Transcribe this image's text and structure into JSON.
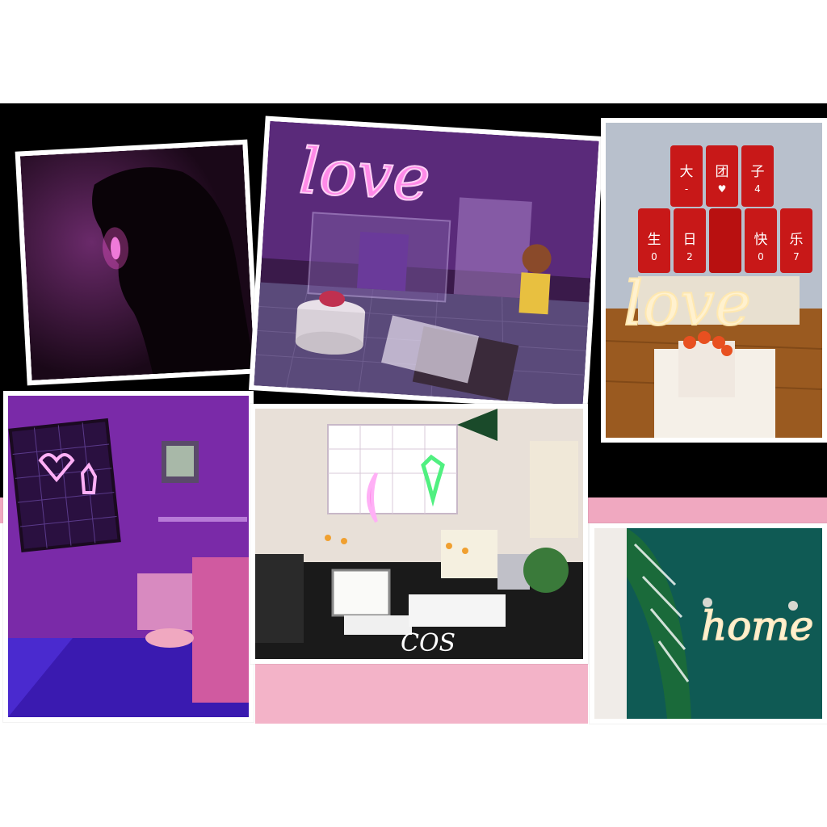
{
  "photos": {
    "love_cake": {
      "neon_sign": "love"
    },
    "cans": {
      "can_chars_top": [
        "大",
        "团",
        "子"
      ],
      "can_chars_top_sub": [
        "-",
        "♥",
        "4"
      ],
      "can_chars_bottom": [
        "生",
        "日",
        "",
        "快",
        "乐"
      ],
      "can_chars_bottom_sub": [
        "0",
        "2",
        "",
        "0",
        "7"
      ],
      "neon_sign": "love"
    },
    "desk": {
      "mat_text": "COS"
    },
    "home": {
      "neon_sign": "home"
    }
  },
  "colors": {
    "pink_neon": "#ff5ad8",
    "warm_neon": "#fff1cf",
    "band_black": "#000000",
    "band_pink": "#f0a8c0"
  }
}
